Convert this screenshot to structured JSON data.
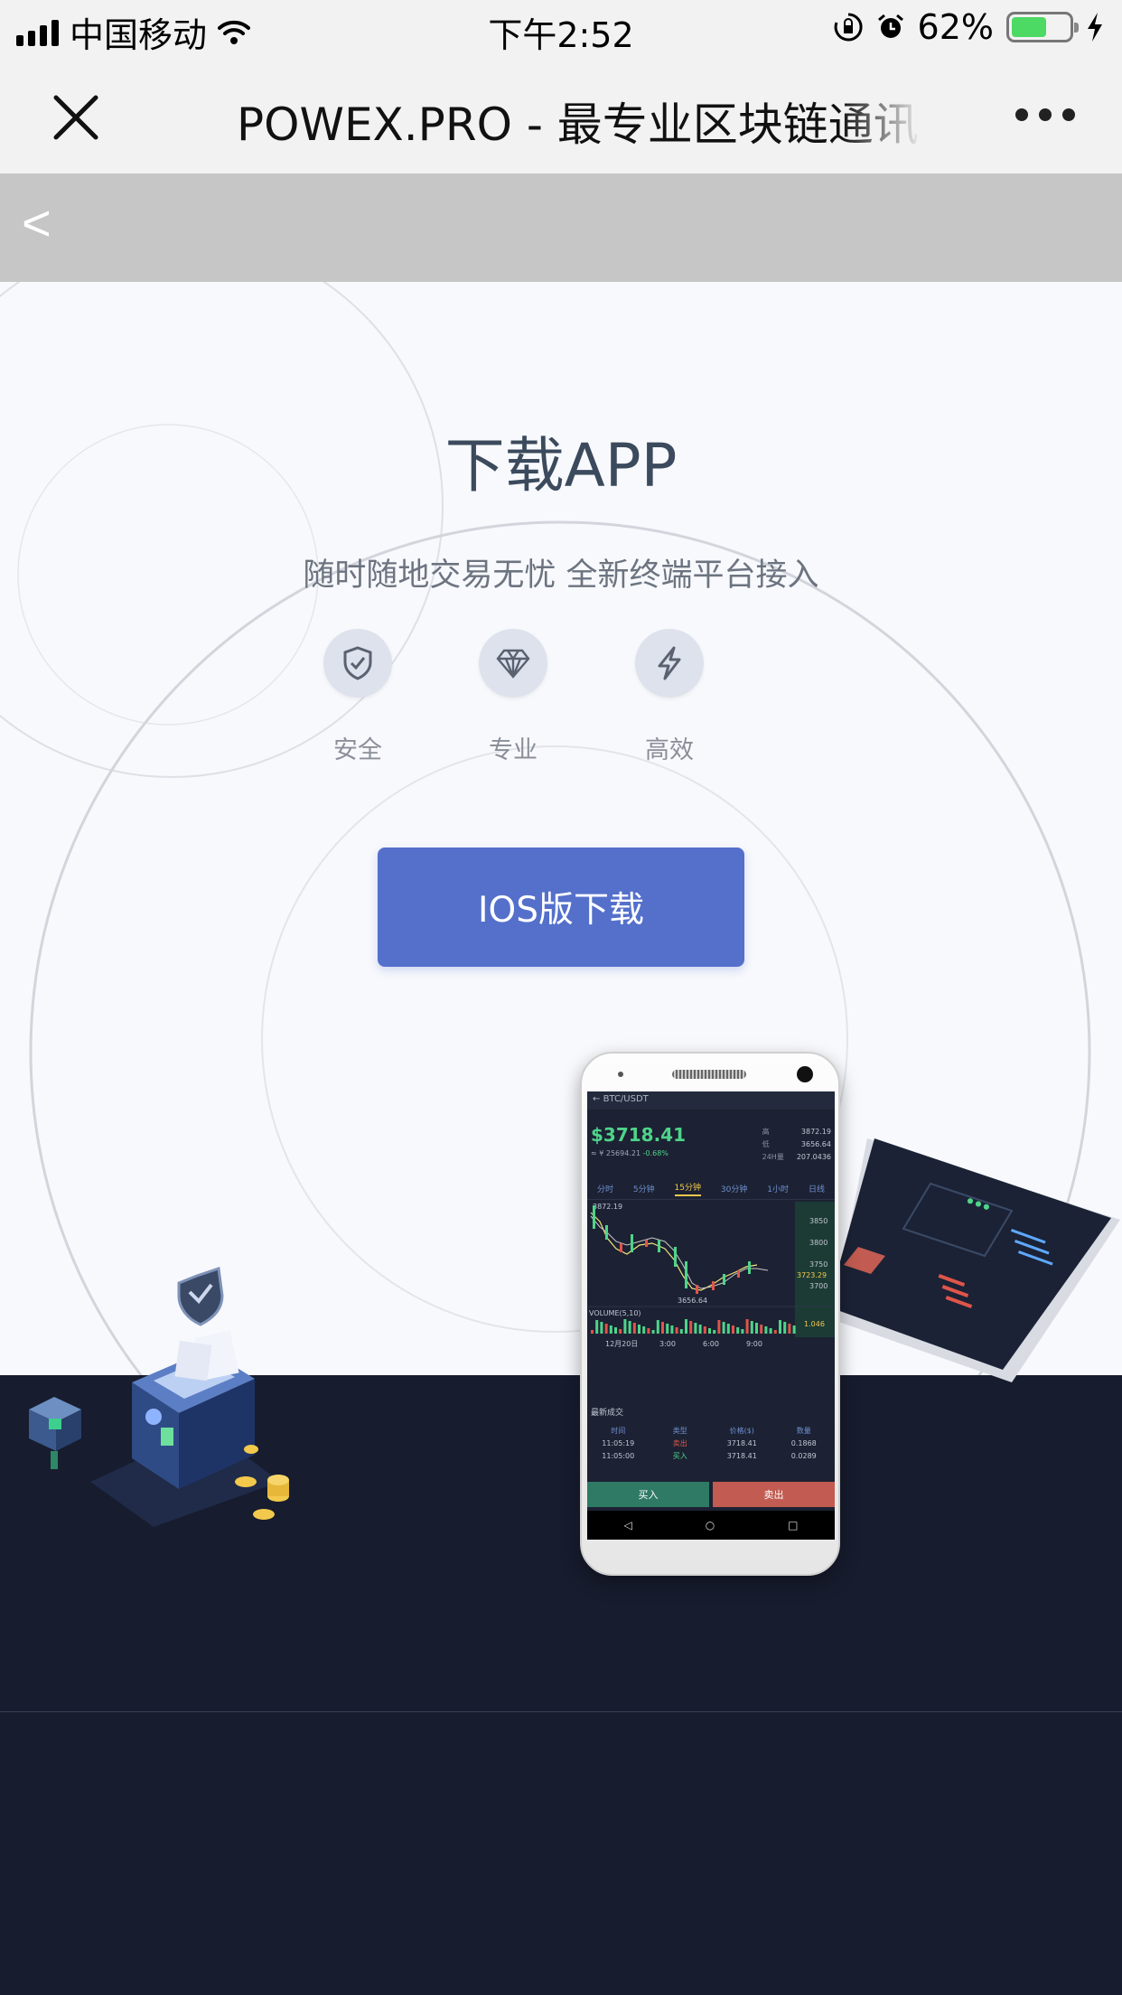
{
  "status_bar": {
    "carrier": "中国移动",
    "time": "下午2:52",
    "battery": "62%",
    "battery_level": 0.62
  },
  "titlebar": {
    "title": "POWEX.PRO - 最专业区块链通讯"
  },
  "page_header": {
    "back_label": "<"
  },
  "hero": {
    "title": "下载APP",
    "subtitle": "随时随地交易无忧 全新终端平台接入",
    "features": [
      {
        "label": "安全",
        "icon": "shield-check-icon"
      },
      {
        "label": "专业",
        "icon": "diamond-icon"
      },
      {
        "label": "高效",
        "icon": "lightning-icon"
      }
    ],
    "download_button": "IOS版下载"
  },
  "phone_screen": {
    "pair": "BTC/USDT",
    "price": "$3718.41",
    "cny": "≈ ¥ 25694.21",
    "change": "-0.68%",
    "stats": [
      {
        "k": "高",
        "v": "3872.19"
      },
      {
        "k": "低",
        "v": "3656.64"
      },
      {
        "k": "24H量",
        "v": "207.0436"
      }
    ],
    "tabs": [
      "分时",
      "5分钟",
      "15分钟",
      "30分钟",
      "1小时",
      "日线"
    ],
    "active_tab": 2,
    "chart_labels": {
      "high": "3872.19",
      "low": "3656.64",
      "last": "3723.29",
      "y_ticks": [
        "3850",
        "3800",
        "3750",
        "3700"
      ],
      "volume": "VOLUME(5,10)",
      "vol_last": "1.046",
      "x_ticks": [
        "12月20日",
        "3:00",
        "6:00",
        "9:00"
      ]
    },
    "trades_title": "最新成交",
    "trade_headers": [
      "时间",
      "类型",
      "价格($)",
      "数量"
    ],
    "trades": [
      [
        "11:05:19",
        "卖出",
        "3718.41",
        "0.1868"
      ],
      [
        "11:05:00",
        "买入",
        "3718.41",
        "0.0289"
      ]
    ],
    "buy_label": "买入",
    "sell_label": "卖出"
  },
  "colors": {
    "accent": "#5470cb",
    "dark_bg": "#171c2e",
    "hero_bg": "#f8f9fd",
    "header_grey": "#c6c6c6"
  }
}
